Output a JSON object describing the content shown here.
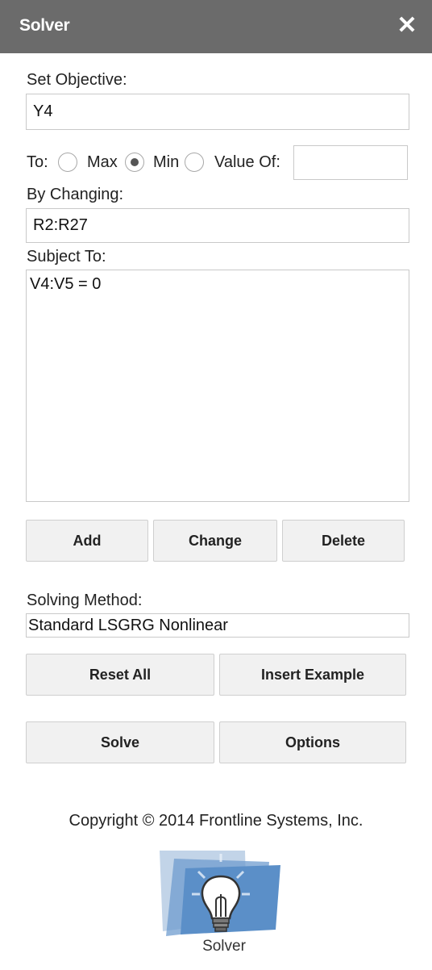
{
  "window": {
    "title": "Solver",
    "close_icon": "close-icon"
  },
  "objective": {
    "label": "Set Objective:",
    "value": "Y4"
  },
  "to": {
    "label": "To:",
    "options": [
      {
        "label": "Max",
        "checked": false
      },
      {
        "label": "Min",
        "checked": true
      },
      {
        "label": "Value Of:",
        "checked": false
      }
    ],
    "value_of": ""
  },
  "changing": {
    "label": "By Changing:",
    "value": "R2:R27"
  },
  "subject": {
    "label": "Subject To:",
    "constraints": [
      "V4:V5 = 0"
    ]
  },
  "constraint_buttons": {
    "add": "Add",
    "change": "Change",
    "delete": "Delete"
  },
  "method": {
    "label": "Solving Method:",
    "value": "Standard LSGRG Nonlinear"
  },
  "action_buttons": {
    "reset": "Reset All",
    "insert_example": "Insert Example",
    "solve": "Solve",
    "options": "Options"
  },
  "footer": {
    "copyright": "Copyright © 2014 Frontline Systems, Inc.",
    "logo_label": "Solver",
    "logo_icon": "lightbulb-icon"
  }
}
